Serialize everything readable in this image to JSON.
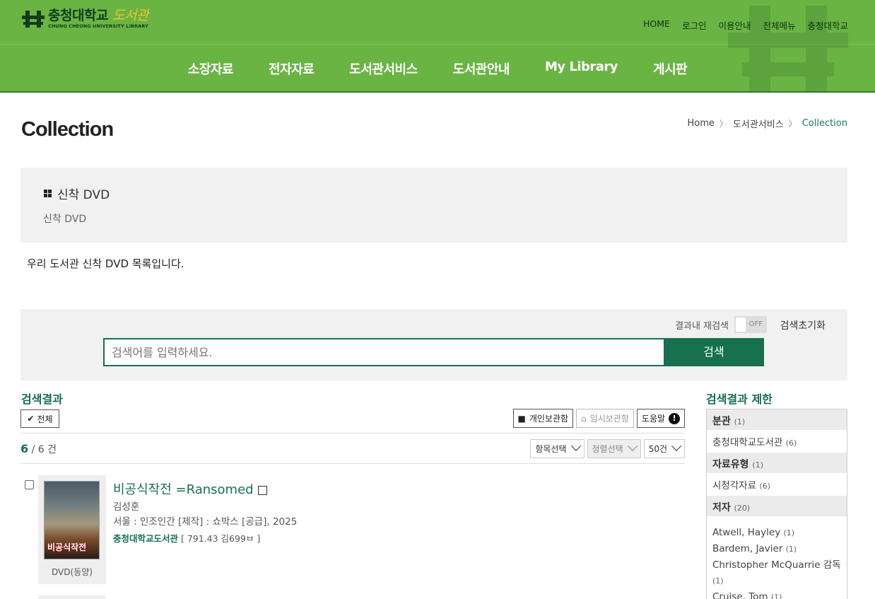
{
  "header": {
    "logo_kor": "충청대학교",
    "logo_lib": "도서관",
    "logo_eng": "CHUNG CHEONG UNIVERSITY LIBRARY",
    "util_links": [
      "HOME",
      "로그인",
      "이용안내",
      "전체메뉴",
      "충청대학교"
    ],
    "gnb": [
      "소장자료",
      "전자자료",
      "도서관서비스",
      "도서관안내",
      "My Library",
      "게시판"
    ]
  },
  "page": {
    "title": "Collection",
    "breadcrumb": [
      "Home",
      "도서관서비스",
      "Collection"
    ]
  },
  "info": {
    "title": "신착 DVD",
    "subtitle": "신착 DVD",
    "description": "우리 도서관 신착 DVD 목록입니다."
  },
  "search": {
    "research_label": "결과내 재검색",
    "toggle_state": "OFF",
    "reset_label": "검색초기화",
    "placeholder": "검색어를 입력하세요.",
    "button": "검색"
  },
  "results": {
    "title": "검색결과",
    "select_all": "전체",
    "tools": [
      "개인보관함",
      "임시보관함",
      "도움말"
    ],
    "count_current": "6",
    "count_total": "/ 6 건",
    "sorts": [
      "항목선택",
      "정렬선택",
      "50건"
    ],
    "items": [
      {
        "title": "비공식작전 =Ransomed",
        "author": "김성훈",
        "publisher": "서울 : 인조인간 [제작] : 쇼박스 [공급], 2025",
        "library": "충청대학교도서관",
        "callno": "[ 791.43 김699ㅂ ]",
        "cover_text": "비공식작전",
        "type": "DVD(동양)"
      }
    ]
  },
  "facets": {
    "title": "검색결과 제한",
    "groups": [
      {
        "name": "분관",
        "count": "(1)",
        "items": [
          {
            "label": "충청대학교도서관",
            "count": "(6)"
          }
        ]
      },
      {
        "name": "자료유형",
        "count": "(1)",
        "items": [
          {
            "label": "시청각자료",
            "count": "(6)"
          }
        ]
      },
      {
        "name": "저자",
        "count": "(20)",
        "items": [
          {
            "label": "Atwell, Hayley",
            "count": "(1)"
          },
          {
            "label": "Bardem, Javier",
            "count": "(1)"
          },
          {
            "label": "Christopher McQuarrie 감독",
            "count": "(1)"
          },
          {
            "label": "Cruise, Tom",
            "count": "(1)"
          }
        ]
      }
    ]
  },
  "colors": {
    "header_green": "#6ab443",
    "accent": "#17704f"
  }
}
